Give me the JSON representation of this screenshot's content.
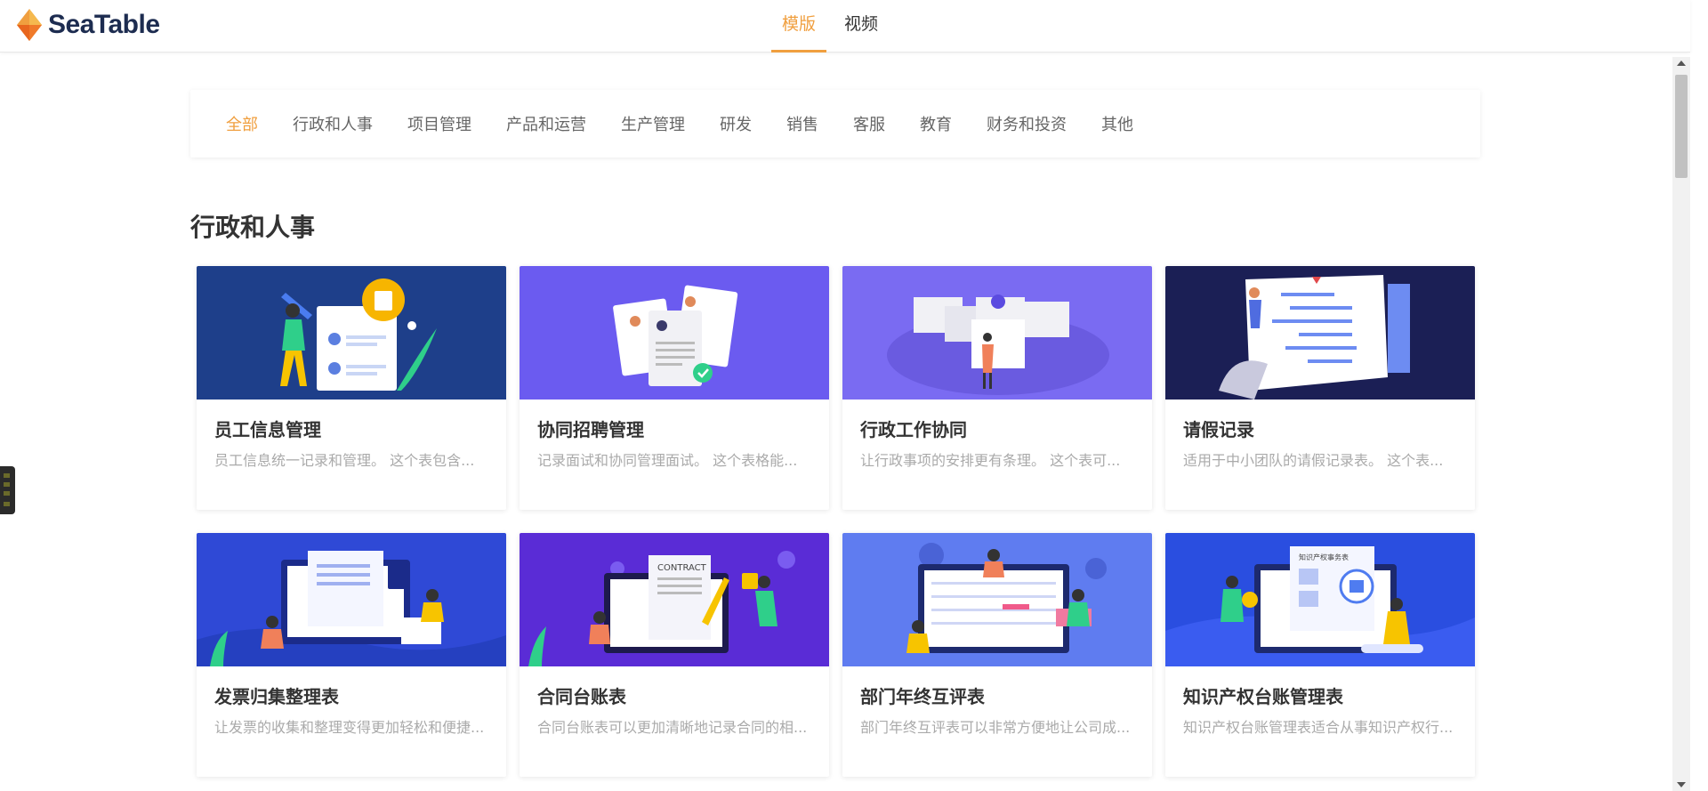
{
  "app": {
    "brand": "SeaTable",
    "brand_color": "#f09f3f"
  },
  "topnav": {
    "items": [
      {
        "label": "模版",
        "active": true
      },
      {
        "label": "视频",
        "active": false
      }
    ]
  },
  "filter": {
    "categories": [
      {
        "label": "全部",
        "active": true
      },
      {
        "label": "行政和人事"
      },
      {
        "label": "项目管理"
      },
      {
        "label": "产品和运营"
      },
      {
        "label": "生产管理"
      },
      {
        "label": "研发"
      },
      {
        "label": "销售"
      },
      {
        "label": "客服"
      },
      {
        "label": "教育"
      },
      {
        "label": "财务和投资"
      },
      {
        "label": "其他"
      }
    ]
  },
  "section": {
    "title": "行政和人事"
  },
  "cards": [
    {
      "title": "员工信息管理",
      "desc": "员工信息统一记录和管理。 这个表包含...",
      "bg": "#1e3f8a"
    },
    {
      "title": "协同招聘管理",
      "desc": "记录面试和协同管理面试。 这个表格能...",
      "bg": "#6b5bf0"
    },
    {
      "title": "行政工作协同",
      "desc": "让行政事项的安排更有条理。 这个表可...",
      "bg": "#7a6bf2"
    },
    {
      "title": "请假记录",
      "desc": "适用于中小团队的请假记录表。 这个表...",
      "bg": "#1b1f55"
    },
    {
      "title": "发票归集整理表",
      "desc": "让发票的收集和整理变得更加轻松和便捷...",
      "bg": "#2f49d6"
    },
    {
      "title": "合同台账表",
      "desc": "合同台账表可以更加清晰地记录合同的相...",
      "bg": "#5a2cd6"
    },
    {
      "title": "部门年终互评表",
      "desc": "部门年终互评表可以非常方便地让公司成...",
      "bg": "#5f7cf0"
    },
    {
      "title": "知识产权台账管理表",
      "desc": "知识产权台账管理表适合从事知识产权行...",
      "bg": "#2a4ee0"
    }
  ],
  "thumb_texts": {
    "contract": "CONTRACT",
    "ip_doc": "知识产权事务表"
  }
}
